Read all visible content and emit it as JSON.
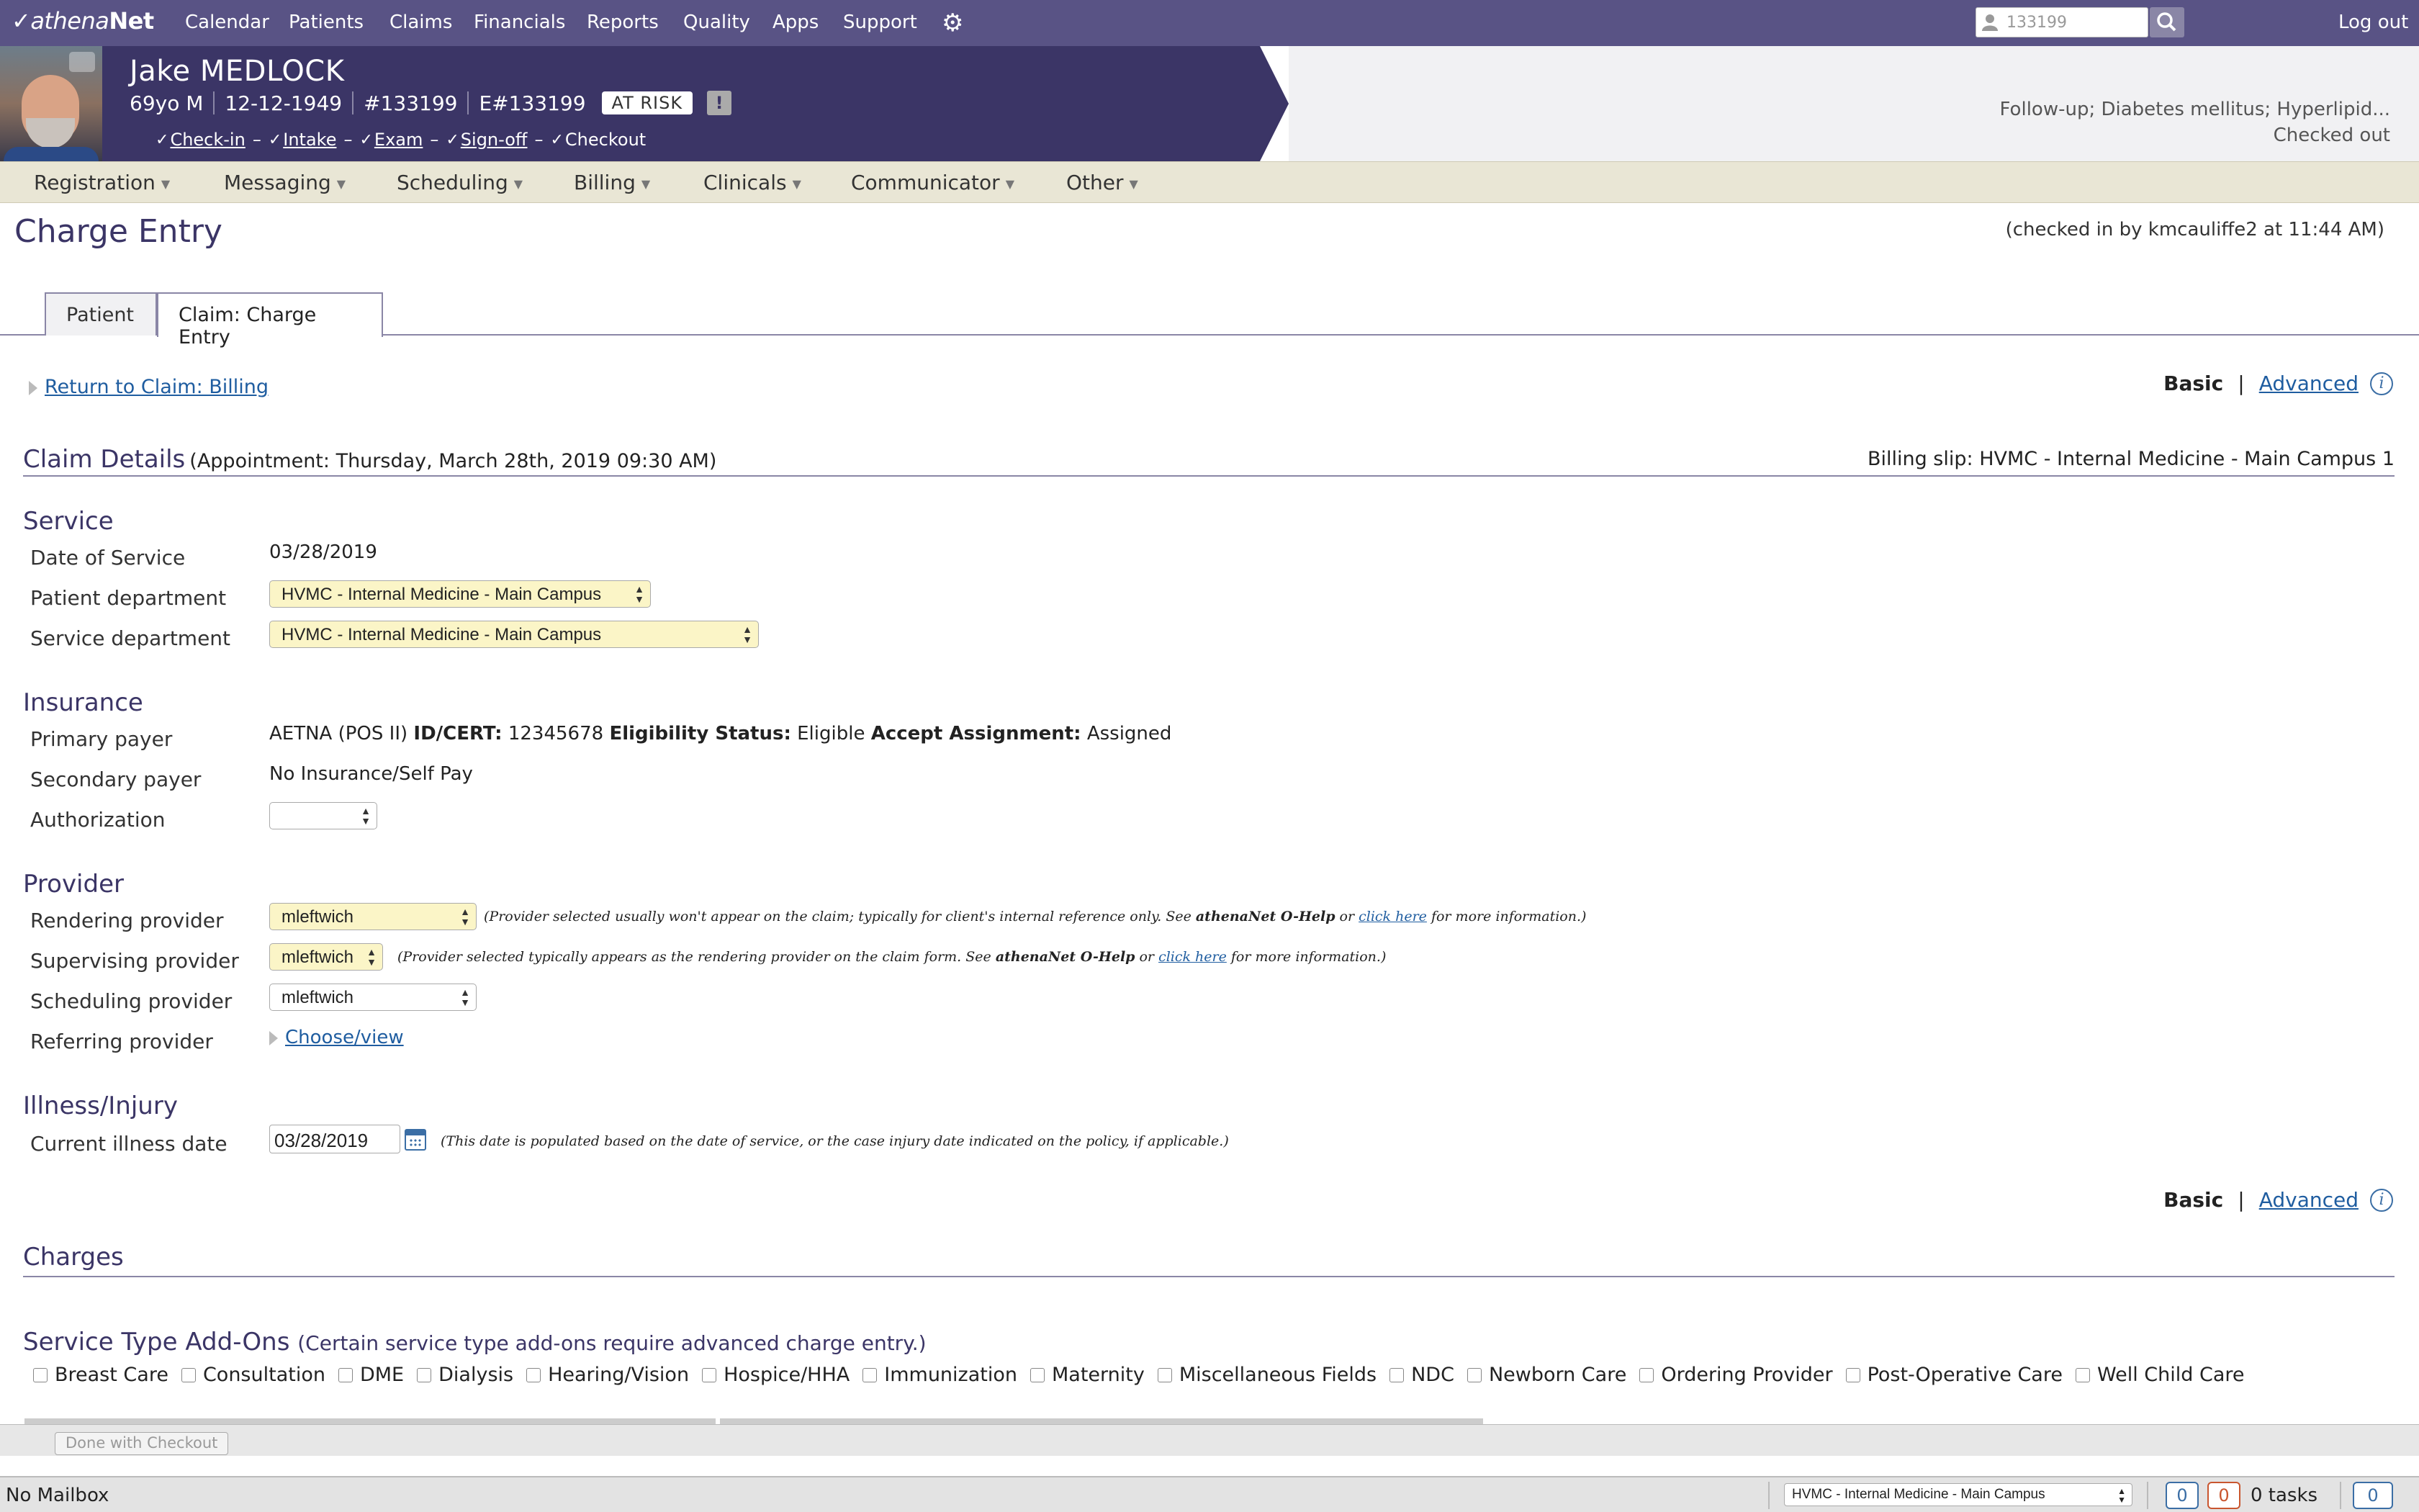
{
  "topnav": {
    "logo_prefix": "athena",
    "logo_suffix": "Net",
    "items": [
      "Calendar",
      "Patients",
      "Claims",
      "Financials",
      "Reports",
      "Quality",
      "Apps",
      "Support"
    ],
    "search_value": "133199",
    "logout": "Log out"
  },
  "patient": {
    "name": "Jake MEDLOCK",
    "age_sex": "69yo M",
    "dob": "12-12-1949",
    "mrn": "#133199",
    "enterprise_id": "E#133199",
    "risk_badge": "AT RISK",
    "alert": "!",
    "workflow": [
      "Check-in",
      "Intake",
      "Exam",
      "Sign-off",
      "Checkout"
    ],
    "visit_reason": "Follow-up; Diabetes mellitus; Hyperlipid...",
    "visit_status": "Checked out"
  },
  "modules": [
    "Registration",
    "Messaging",
    "Scheduling",
    "Billing",
    "Clinicals",
    "Communicator",
    "Other"
  ],
  "page": {
    "title": "Charge Entry",
    "checked_in": "(checked in by kmcauliffe2 at 11:44 AM)",
    "tabs": [
      "Patient",
      "Claim: Charge Entry"
    ],
    "back_link": "Return to Claim: Billing",
    "mode_basic": "Basic",
    "mode_sep": "|",
    "mode_advanced": "Advanced"
  },
  "claim": {
    "heading": "Claim Details",
    "appointment": "(Appointment: Thursday, March 28th, 2019 09:30 AM)",
    "billing_slip": "Billing slip: HVMC - Internal Medicine - Main Campus 1"
  },
  "service": {
    "heading": "Service",
    "date_label": "Date of Service",
    "date_value": "03/28/2019",
    "patient_dept_label": "Patient department",
    "patient_dept_value": "HVMC - Internal Medicine - Main Campus",
    "service_dept_label": "Service department",
    "service_dept_value": "HVMC - Internal Medicine - Main Campus"
  },
  "insurance": {
    "heading": "Insurance",
    "primary_label": "Primary payer",
    "primary_name": "AETNA (POS II)",
    "id_label": "ID/CERT:",
    "id_value": "12345678",
    "elig_label": "Eligibility Status:",
    "elig_value": "Eligible",
    "assign_label": "Accept Assignment:",
    "assign_value": "Assigned",
    "secondary_label": "Secondary payer",
    "secondary_value": "No Insurance/Self Pay",
    "auth_label": "Authorization",
    "auth_value": ""
  },
  "provider": {
    "heading": "Provider",
    "rendering_label": "Rendering provider",
    "rendering_value": "mleftwich",
    "rendering_note_1": "(Provider selected usually won't appear on the claim; typically for client's internal reference only. See ",
    "rendering_note_help": "athenaNet O-Help",
    "rendering_note_or": " or ",
    "rendering_note_link": "click here",
    "rendering_note_end": " for more information.)",
    "supervising_label": "Supervising provider",
    "supervising_value": "mleftwich",
    "supervising_note_1": "(Provider selected typically appears as the rendering provider on the claim form. See ",
    "supervising_note_help": "athenaNet O-Help",
    "supervising_note_or": " or ",
    "supervising_note_link": "click here",
    "supervising_note_end": " for more information.)",
    "scheduling_label": "Scheduling provider",
    "scheduling_value": "mleftwich",
    "referring_label": "Referring provider",
    "referring_link": "Choose/view"
  },
  "illness": {
    "heading": "Illness/Injury",
    "current_label": "Current illness date",
    "current_value": "03/28/2019",
    "note": "(This date is populated based on the date of service, or the case injury date indicated on the policy, if applicable.)"
  },
  "charges": {
    "heading": "Charges",
    "addons_heading": "Service Type Add-Ons",
    "addons_sub": "(Certain service type add-ons require advanced charge entry.)",
    "addons": [
      "Breast Care",
      "Consultation",
      "DME",
      "Dialysis",
      "Hearing/Vision",
      "Hospice/HHA",
      "Immunization",
      "Maternity",
      "Miscellaneous Fields",
      "NDC",
      "Newborn Care",
      "Ordering Provider",
      "Post-Operative Care",
      "Well Child Care"
    ]
  },
  "footer": {
    "done_button": "Done with Checkout",
    "mailbox": "No Mailbox",
    "department": "HVMC - Internal Medicine - Main Campus",
    "count_blue": "0",
    "count_red": "0",
    "tasks": "0 tasks",
    "chat_count": "0"
  },
  "colors": {
    "nav": "#595385",
    "banner": "#3b3566",
    "module_bar": "#e9e6d5",
    "heading": "#3b3566",
    "select_highlight": "#fbf5c7",
    "link": "#1f5da0"
  },
  "icons": [
    "person-icon",
    "search-icon",
    "gear-icon",
    "camera-icon",
    "check-icon",
    "info-icon",
    "calendar-icon",
    "chat-icon"
  ]
}
